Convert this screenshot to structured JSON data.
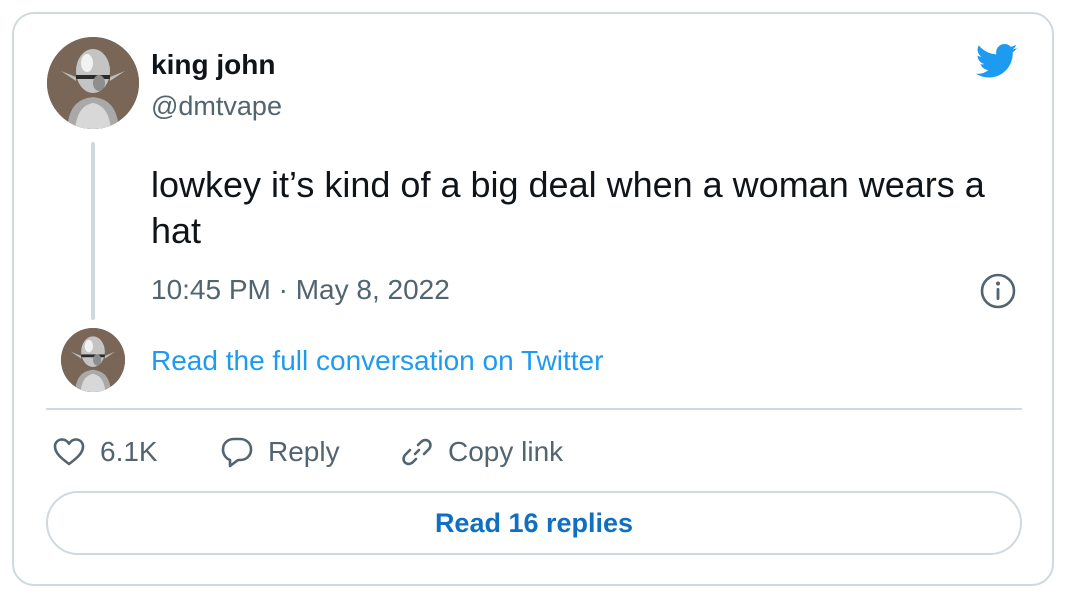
{
  "tweet": {
    "author_name": "king john",
    "author_handle": "@dmtvape",
    "text": "lowkey it’s kind of a big deal when a woman wears a hat",
    "timestamp": "10:45 PM · May 8, 2022"
  },
  "thread": {
    "read_full_label": "Read the full conversation on Twitter"
  },
  "actions": {
    "like_count": "6.1K",
    "reply_label": "Reply",
    "copy_link_label": "Copy link"
  },
  "footer": {
    "read_replies_label": "Read 16 replies"
  },
  "icons": {
    "brand": "twitter-bird-icon",
    "info": "info-icon",
    "like": "heart-icon",
    "reply": "speech-bubble-icon",
    "copy": "link-icon"
  },
  "colors": {
    "accent": "#1d9bf0",
    "replies_text": "#0f6fc0",
    "secondary_text": "#536471",
    "border": "#cfd9de"
  }
}
